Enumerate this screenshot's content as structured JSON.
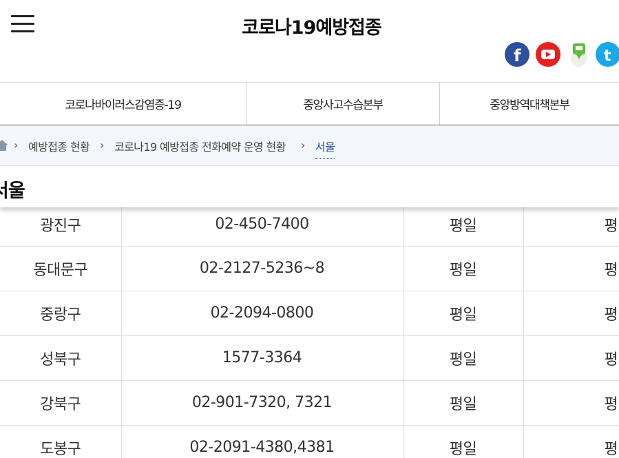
{
  "header": {
    "menu_icon": "hamburger-menu-icon",
    "title": "코로나19예방접종",
    "sns": [
      {
        "name": "facebook-icon",
        "color": "#2d4f9e"
      },
      {
        "name": "youtube-icon",
        "color": "#e81f1f"
      },
      {
        "name": "blog-icon",
        "color": "#5fbf3a"
      },
      {
        "name": "twitter-icon",
        "color": "#1ba8e8"
      }
    ]
  },
  "nav": {
    "tabs": [
      {
        "label": "코로나바이러스감염증-19"
      },
      {
        "label": "중앙사고수습본부"
      },
      {
        "label": "중앙방역대책본부"
      }
    ]
  },
  "breadcrumb": {
    "home_icon": "home-icon",
    "items": [
      "예방접종 현황",
      "코로나19 예방접종 전화예약 운영 현황",
      "서울"
    ]
  },
  "page": {
    "heading": "서울"
  },
  "table": {
    "rows": [
      {
        "district": "광진구",
        "phone": "02-450-7400",
        "days": "평일",
        "extra": "평"
      },
      {
        "district": "동대문구",
        "phone": "02-2127-5236~8",
        "days": "평일",
        "extra": "평"
      },
      {
        "district": "중랑구",
        "phone": "02-2094-0800",
        "days": "평일",
        "extra": "평"
      },
      {
        "district": "성북구",
        "phone": "1577-3364",
        "days": "평일",
        "extra": "평"
      },
      {
        "district": "강북구",
        "phone": "02-901-7320, 7321",
        "days": "평일",
        "extra": "평"
      },
      {
        "district": "도봉구",
        "phone": "02-2091-4380,4381",
        "days": "평일",
        "extra": "평"
      }
    ]
  }
}
